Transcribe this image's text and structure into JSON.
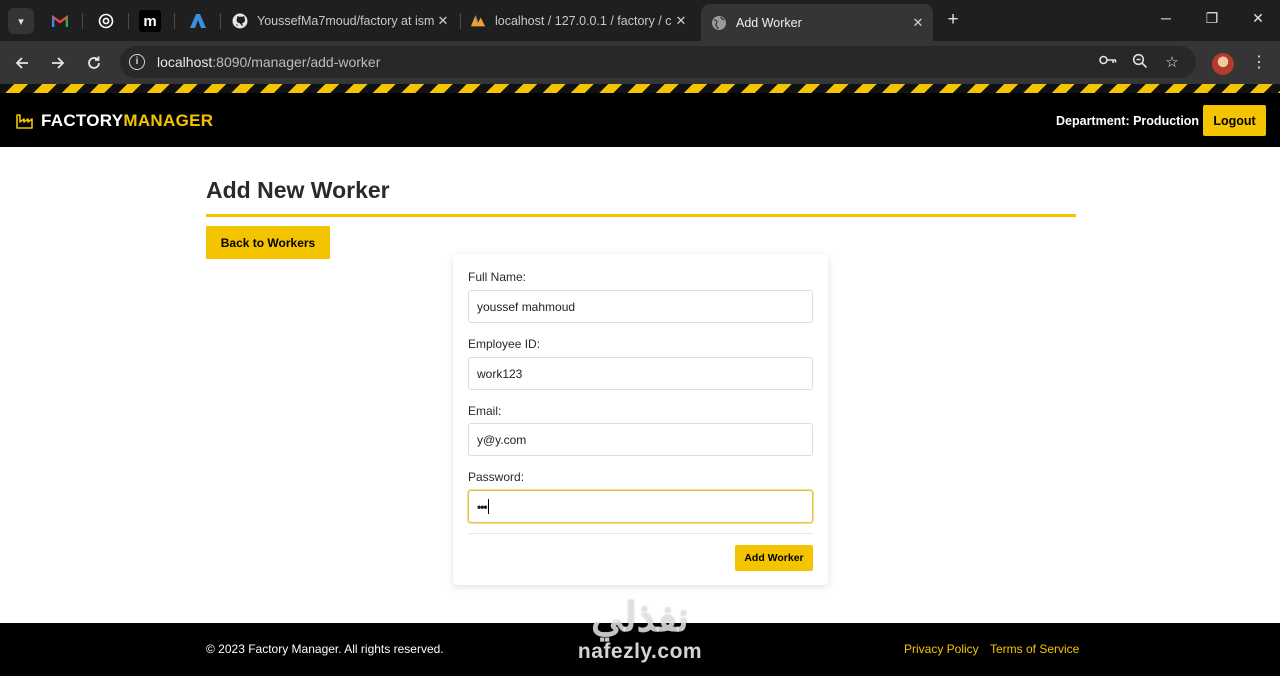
{
  "browser": {
    "tabs": [
      {
        "title": "YoussefMa7moud/factory at ism",
        "favicon": "github-icon"
      },
      {
        "title": "localhost / 127.0.0.1 / factory / c",
        "favicon": "phpmyadmin-icon"
      },
      {
        "title": "Add Worker",
        "favicon": "globe-icon",
        "active": true
      }
    ],
    "url_host": "localhost",
    "url_path": ":8090/manager/add-worker"
  },
  "header": {
    "logo_part1": "FACTORY",
    "logo_part2": "MANAGER",
    "department": "Department: Production",
    "logout_label": "Logout"
  },
  "page": {
    "title": "Add New Worker",
    "back_label": "Back to Workers"
  },
  "form": {
    "full_name_label": "Full Name:",
    "full_name_value": "youssef mahmoud",
    "employee_id_label": "Employee ID:",
    "employee_id_value": "work123",
    "email_label": "Email:",
    "email_value": "y@y.com",
    "password_label": "Password:",
    "password_value": "•••",
    "submit_label": "Add Worker"
  },
  "footer": {
    "copyright": "© 2023 Factory Manager. All rights reserved.",
    "privacy": "Privacy Policy",
    "terms": "Terms of Service"
  },
  "watermark": {
    "arabic": "نفذلي",
    "latin": "nafezly.com"
  },
  "colors": {
    "accent": "#f5c400",
    "header_bg": "#000000",
    "text": "#2a2a2a"
  }
}
